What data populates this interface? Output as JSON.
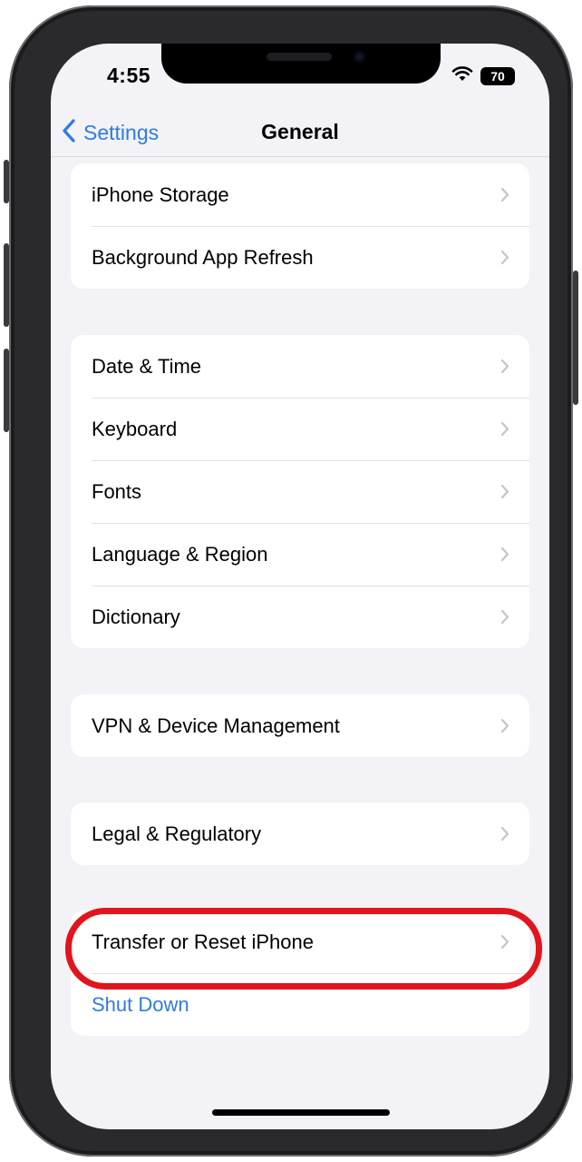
{
  "status_bar": {
    "time": "4:55",
    "battery": "70"
  },
  "nav": {
    "back_label": "Settings",
    "title": "General"
  },
  "groups": [
    {
      "rows": [
        {
          "label": "iPhone Storage"
        },
        {
          "label": "Background App Refresh"
        }
      ]
    },
    {
      "rows": [
        {
          "label": "Date & Time"
        },
        {
          "label": "Keyboard"
        },
        {
          "label": "Fonts"
        },
        {
          "label": "Language & Region"
        },
        {
          "label": "Dictionary"
        }
      ]
    },
    {
      "rows": [
        {
          "label": "VPN & Device Management"
        }
      ]
    },
    {
      "rows": [
        {
          "label": "Legal & Regulatory"
        }
      ]
    },
    {
      "rows": [
        {
          "label": "Transfer or Reset iPhone"
        },
        {
          "label": "Shut Down"
        }
      ]
    }
  ],
  "colors": {
    "accent": "#2f7be0",
    "highlight": "#e2151c",
    "background": "#f2f2f7"
  },
  "icons": {
    "back": "chevron-left-icon",
    "row": "chevron-right-icon",
    "wifi": "wifi-icon",
    "battery": "battery-icon"
  }
}
